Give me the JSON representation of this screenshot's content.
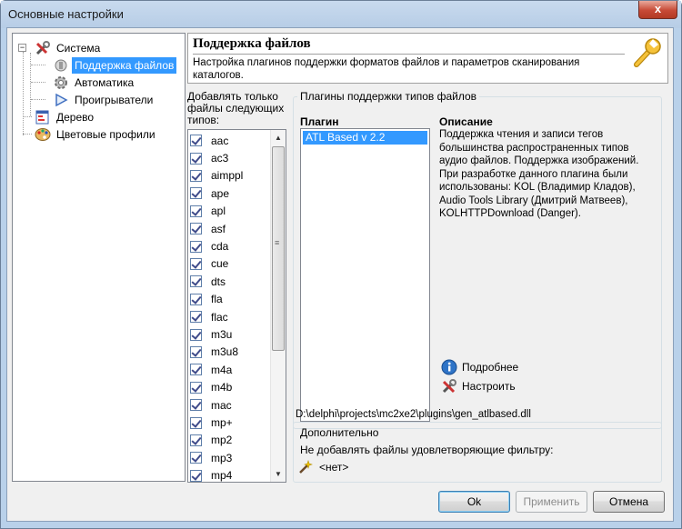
{
  "window": {
    "title": "Основные настройки",
    "close_glyph": "x"
  },
  "tree": {
    "items": [
      {
        "label": "Система",
        "icon": "tools-icon"
      },
      {
        "label": "Поддержка файлов",
        "icon": "plugin-icon",
        "selected": true
      },
      {
        "label": "Автоматика",
        "icon": "gear-icon"
      },
      {
        "label": "Проигрыватели",
        "icon": "play-icon"
      },
      {
        "label": "Дерево",
        "icon": "tree-window-icon"
      },
      {
        "label": "Цветовые профили",
        "icon": "palette-icon"
      }
    ],
    "expander_glyph": "−"
  },
  "header": {
    "title": "Поддержка файлов",
    "description": "Настройка плагинов поддержки форматов файлов и параметров сканирования каталогов.",
    "icon": "wrench-icon"
  },
  "extensions": {
    "caption": "Добавлять только файлы следующих типов:",
    "items": [
      "aac",
      "ac3",
      "aimppl",
      "ape",
      "apl",
      "asf",
      "cda",
      "cue",
      "dts",
      "fla",
      "flac",
      "m3u",
      "m3u8",
      "m4a",
      "m4b",
      "mac",
      "mp+",
      "mp2",
      "mp3",
      "mp4"
    ],
    "checked": true,
    "scroll_up": "▲",
    "scroll_down": "▼",
    "thumb_grip": "≡"
  },
  "plugins": {
    "group_title": "Плагины поддержки типов файлов",
    "plugin_header": "Плагин",
    "description_header": "Описание",
    "list": [
      "ATL Based v 2.2"
    ],
    "description": "Поддержка чтения и записи тегов большинства распространенных типов аудио файлов. Поддержка изображений. При разработке данного плагина были использованы: KOL (Владимир Кладов), Audio Tools Library (Дмитрий Матвеев), KOLHTTPDownload (Danger).",
    "more_label": "Подробнее",
    "configure_label": "Настроить",
    "path": "D:\\delphi\\projects\\mc2xe2\\plugins\\gen_atlbased.dll"
  },
  "extra": {
    "title": "Дополнительно",
    "filter_text": "Не добавлять файлы удовлетворяющие фильтру:",
    "filter_value": "<нет>"
  },
  "buttons": {
    "ok": "Ok",
    "apply": "Применить",
    "cancel": "Отмена"
  },
  "colors": {
    "selection": "#3399ff",
    "window_frame": "#b9d1ea",
    "client_bg": "#f0f0f0"
  }
}
